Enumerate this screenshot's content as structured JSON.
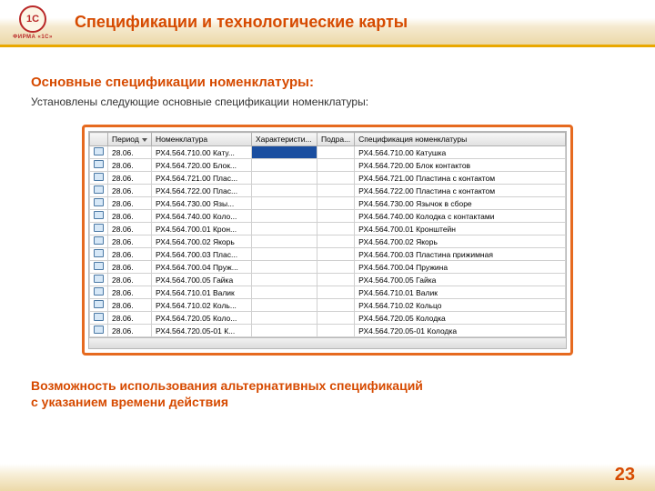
{
  "logo": {
    "brand": "1C",
    "sub": "ФИРМА «1С»"
  },
  "title": "Спецификации и технологические карты",
  "section_title": "Основные спецификации номенклатуры:",
  "section_sub": "Установлены следующие основные спецификации номенклатуры:",
  "table": {
    "headers": {
      "period": "Период",
      "nomen": "Номенклатура",
      "char": "Характеристи...",
      "subd": "Подра...",
      "spec": "Спецификация номенклатуры"
    },
    "rows": [
      {
        "period": "28.06.",
        "nomen": "РХ4.564.710.00 Кату...",
        "spec": "РХ4.564.710.00 Катушка",
        "selected": true
      },
      {
        "period": "28.06.",
        "nomen": "РХ4.564.720.00 Блок...",
        "spec": "РХ4.564.720.00 Блок контактов"
      },
      {
        "period": "28.06.",
        "nomen": "РХ4.564.721.00 Плас...",
        "spec": "РХ4.564.721.00 Пластина с контактом"
      },
      {
        "period": "28.06.",
        "nomen": "РХ4.564.722.00 Плас...",
        "spec": "РХ4.564.722.00 Пластина с контактом"
      },
      {
        "period": "28.06.",
        "nomen": "РХ4.564.730.00 Язы...",
        "spec": "РХ4.564.730.00 Язычок в сборе"
      },
      {
        "period": "28.06.",
        "nomen": "РХ4.564.740.00 Коло...",
        "spec": "РХ4.564.740.00 Колодка с контактами"
      },
      {
        "period": "28.06.",
        "nomen": "РХ4.564.700.01 Крон...",
        "spec": "РХ4.564.700.01 Кронштейн"
      },
      {
        "period": "28.06.",
        "nomen": "РХ4.564.700.02 Якорь",
        "spec": "РХ4.564.700.02 Якорь"
      },
      {
        "period": "28.06.",
        "nomen": "РХ4.564.700.03 Плас...",
        "spec": "РХ4.564.700.03 Пластина прижимная"
      },
      {
        "period": "28.06.",
        "nomen": "РХ4.564.700.04 Пруж...",
        "spec": "РХ4.564.700.04 Пружина"
      },
      {
        "period": "28.06.",
        "nomen": "РХ4.564.700.05 Гайка",
        "spec": "РХ4.564.700.05 Гайка"
      },
      {
        "period": "28.06.",
        "nomen": "РХ4.564.710.01 Валик",
        "spec": "РХ4.564.710.01 Валик"
      },
      {
        "period": "28.06.",
        "nomen": "РХ4.564.710.02 Коль...",
        "spec": "РХ4.564.710.02 Кольцо"
      },
      {
        "period": "28.06.",
        "nomen": "РХ4.564.720.05 Коло...",
        "spec": "РХ4.564.720.05 Колодка"
      },
      {
        "period": "28.06.",
        "nomen": "РХ4.564.720.05-01 К...",
        "spec": "РХ4.564.720.05-01 Колодка"
      }
    ]
  },
  "footnote_l1": "Возможность использования альтернативных спецификаций",
  "footnote_l2": "с указанием времени действия",
  "page": "23"
}
